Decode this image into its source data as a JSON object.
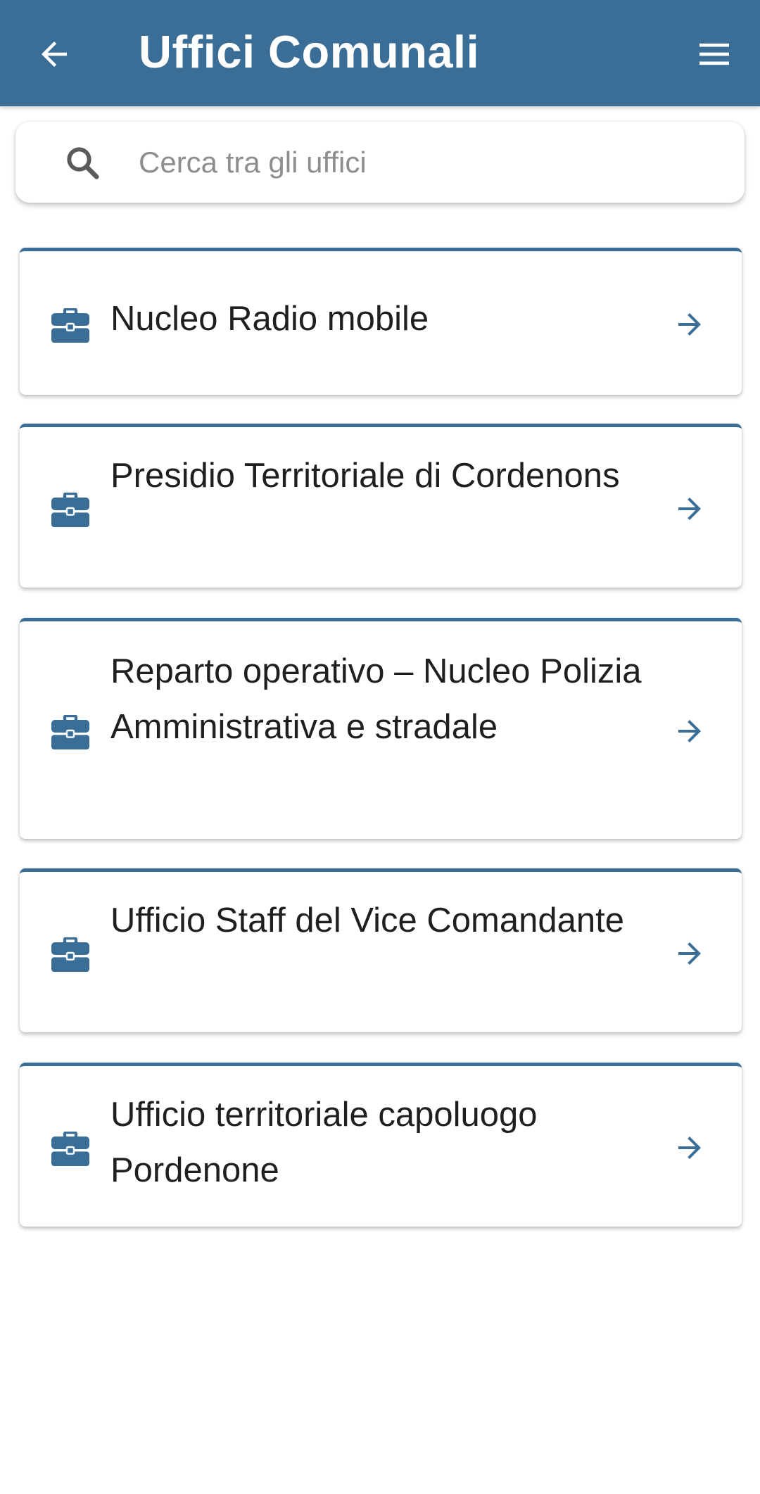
{
  "app_bar": {
    "title": "Uffici Comunali",
    "back_icon": "arrow-left-icon",
    "menu_icon": "hamburger-menu-icon",
    "background_color": "#3b6e96"
  },
  "search": {
    "placeholder": "Cerca tra gli uffici",
    "value": "",
    "icon": "search-icon"
  },
  "offices": [
    {
      "label": "Nucleo Radio mobile",
      "icon": "briefcase-icon",
      "action_icon": "arrow-right-icon"
    },
    {
      "label": "Presidio Territoriale di Cordenons",
      "icon": "briefcase-icon",
      "action_icon": "arrow-right-icon"
    },
    {
      "label": "Reparto operativo – Nucleo Polizia Amministrativa e stradale",
      "icon": "briefcase-icon",
      "action_icon": "arrow-right-icon"
    },
    {
      "label": "Ufficio Staff del Vice Comandante",
      "icon": "briefcase-icon",
      "action_icon": "arrow-right-icon"
    },
    {
      "label": "Ufficio territoriale capoluogo Pordenone",
      "icon": "briefcase-icon",
      "action_icon": "arrow-right-icon"
    }
  ],
  "colors": {
    "accent": "#3b6e96",
    "text": "#1f1f1f",
    "placeholder": "#8e8e8e"
  }
}
